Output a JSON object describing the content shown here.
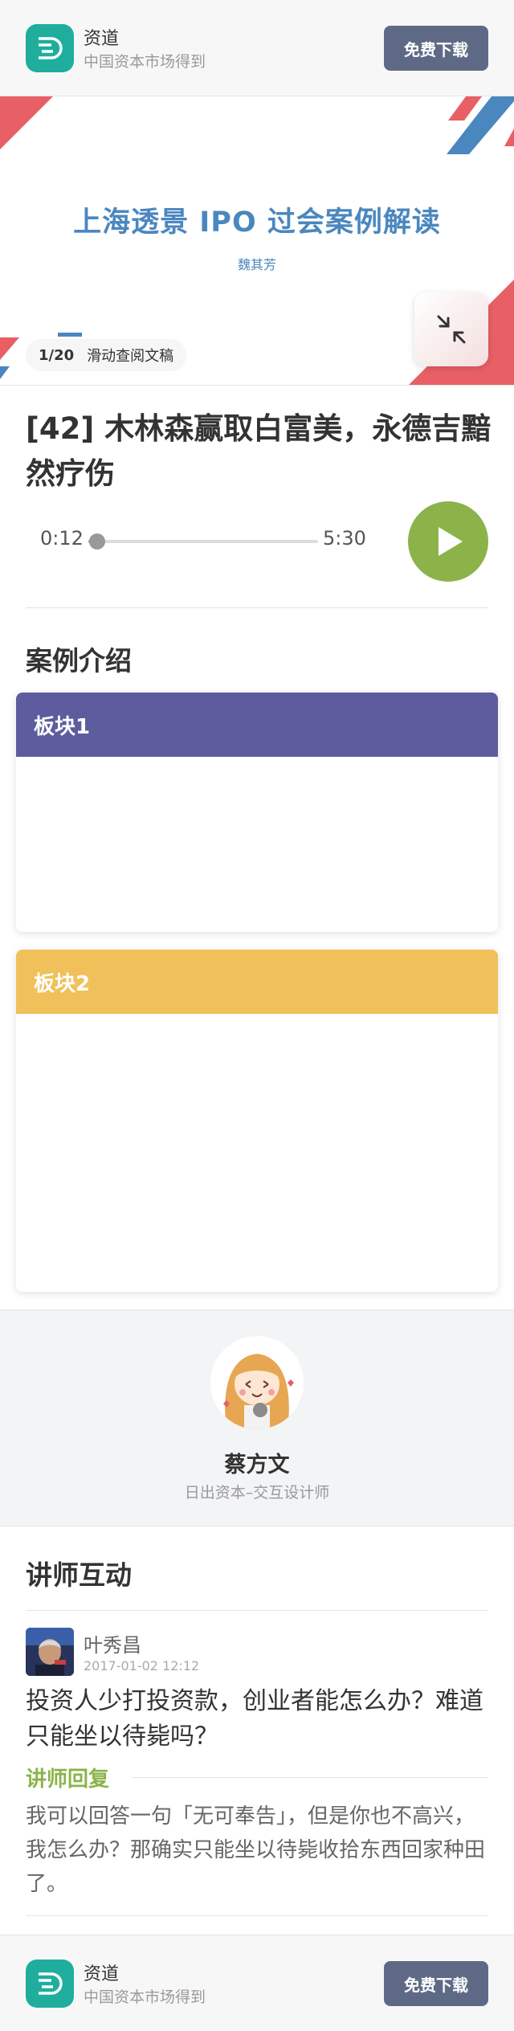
{
  "app": {
    "name": "资道",
    "tagline": "中国资本市场得到",
    "download_label": "免费下载",
    "accent": "#1fae9e"
  },
  "slide": {
    "title": "上海透景 IPO 过会案例解读",
    "author": "魏其芳",
    "counter": "1/20",
    "hint": "滑动查阅文稿"
  },
  "audio": {
    "title": "[42] 木林森赢取白富美，永德吉黯然疗伤",
    "current_time": "0:12",
    "total_time": "5:30",
    "progress": 0.04,
    "play_color": "#8bb34a"
  },
  "cases": {
    "heading": "案例介绍",
    "blocks": [
      {
        "label": "板块1",
        "color": "#5c5c9e"
      },
      {
        "label": "板块2",
        "color": "#f0c05a"
      }
    ]
  },
  "lecturer": {
    "name": "蔡方文",
    "role": "日出资本–交互设计师"
  },
  "interaction": {
    "heading": "讲师互动",
    "comments": [
      {
        "user": "叶秀昌",
        "time": "2017-01-02 12:12",
        "question": "投资人少打投资款，创业者能怎么办？难道只能坐以待毙吗？",
        "reply_label": "讲师回复",
        "reply": "我可以回答一句「无可奉告」，但是你也不高兴，我怎么办？那确实只能坐以待毙收拾东西回家种田了。"
      }
    ]
  }
}
